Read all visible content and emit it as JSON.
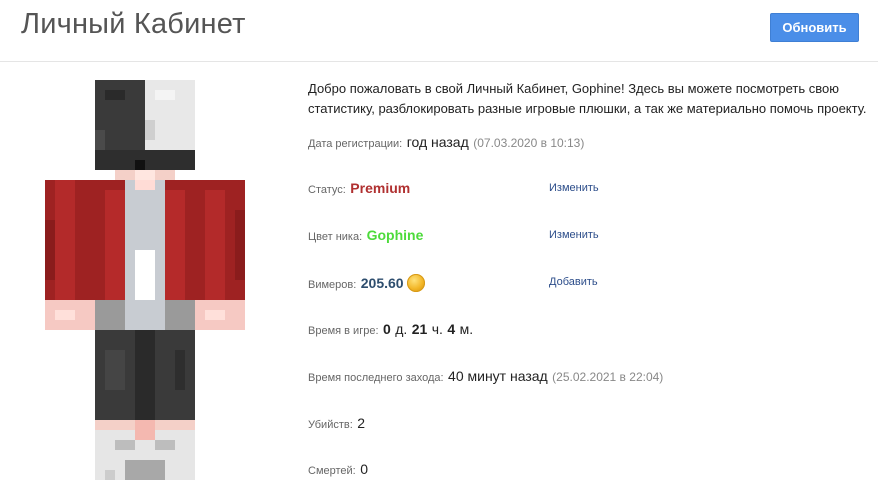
{
  "header": {
    "title": "Личный Кабинет",
    "refresh_label": "Обновить"
  },
  "profile": {
    "welcome": "Добро пожаловать в свой Личный Кабинет, Gophine! Здесь вы можете посмотреть свою статистику, разблокировать разные игровые плюшки, а так же материально помочь проекту.",
    "registration": {
      "label": "Дата регистрации:",
      "value": "год назад",
      "date": "(07.03.2020 в 10:13)"
    },
    "status": {
      "label": "Статус:",
      "value": "Premium",
      "action": "Изменить"
    },
    "nick_color": {
      "label": "Цвет ника:",
      "value": "Gophine",
      "action": "Изменить"
    },
    "vimers": {
      "label": "Вимеров:",
      "value": "205.60",
      "action": "Добавить"
    },
    "playtime": {
      "label": "Время в игре:",
      "days": "0",
      "days_unit": "д.",
      "hours": "21",
      "hours_unit": "ч.",
      "minutes": "4",
      "minutes_unit": "м."
    },
    "last_login": {
      "label": "Время последнего захода:",
      "value": "40 минут назад",
      "date": "(25.02.2021 в 22:04)"
    },
    "kills": {
      "label": "Убийств:",
      "value": "2"
    },
    "deaths": {
      "label": "Смертей:",
      "value": "0"
    }
  },
  "colors": {
    "accent": "#4a8ee8",
    "status": "#b03030",
    "nick": "#4ddb3b",
    "link": "#2c4d8a"
  }
}
